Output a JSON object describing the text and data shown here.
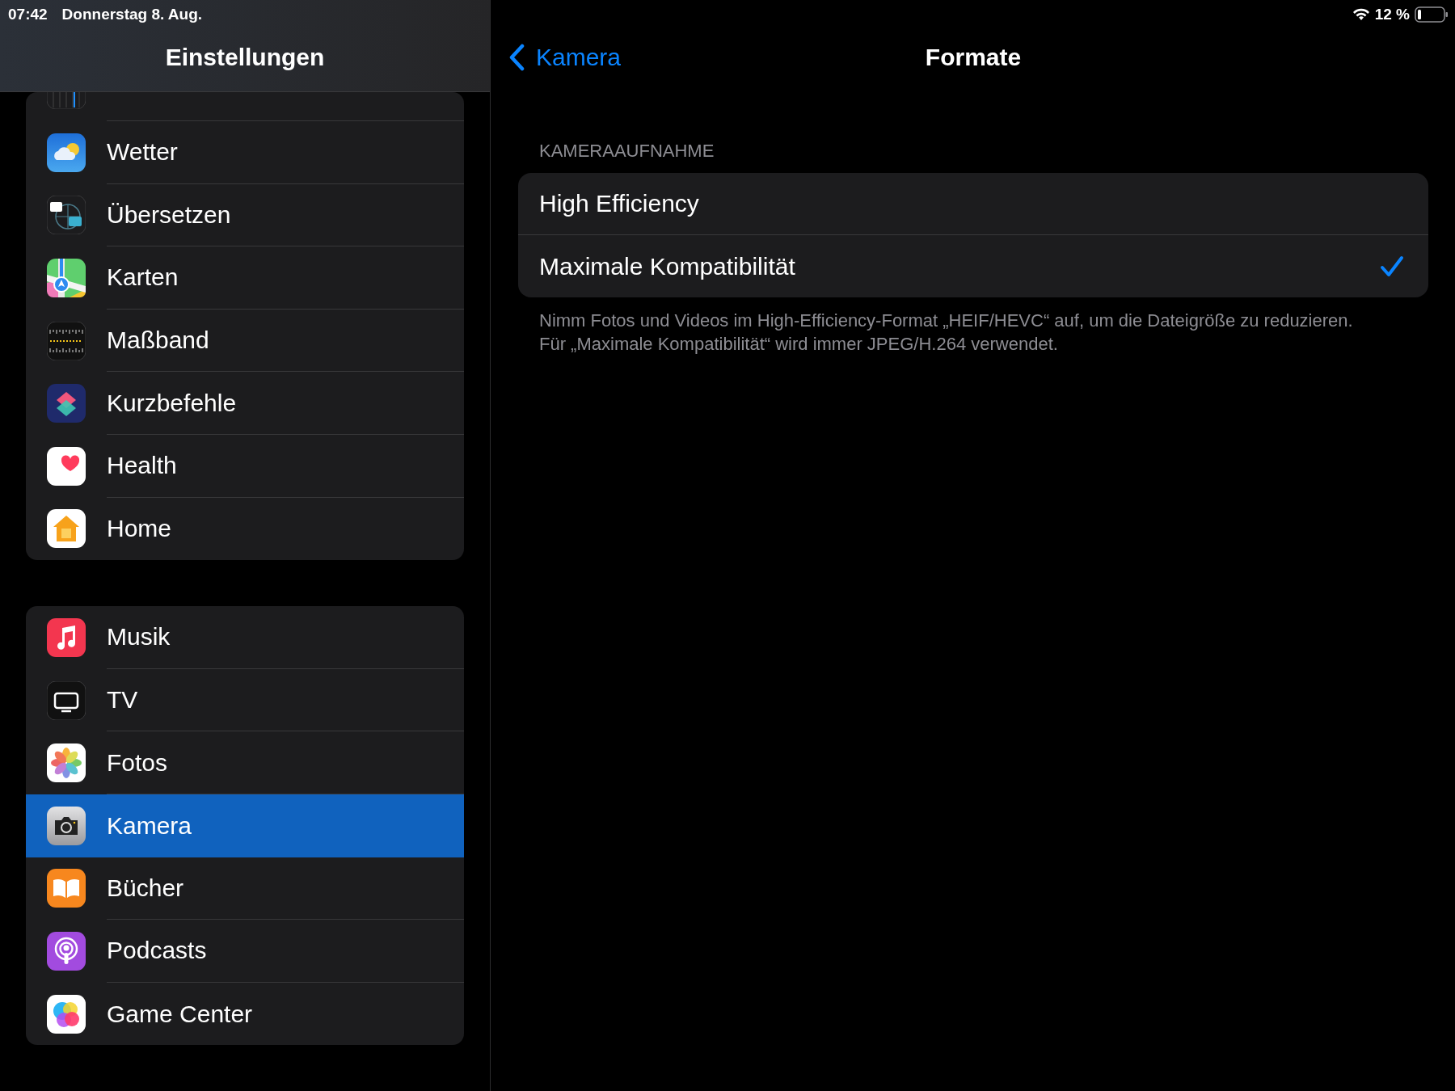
{
  "status_bar": {
    "time": "07:42",
    "date": "Donnerstag 8. Aug.",
    "battery": "12 %"
  },
  "sidebar": {
    "title": "Einstellungen",
    "groups": [
      {
        "items": [
          {
            "label": "Wetter",
            "selected": false
          },
          {
            "label": "Übersetzen",
            "selected": false
          },
          {
            "label": "Karten",
            "selected": false
          },
          {
            "label": "Maßband",
            "selected": false
          },
          {
            "label": "Kurzbefehle",
            "selected": false
          },
          {
            "label": "Health",
            "selected": false
          },
          {
            "label": "Home",
            "selected": false
          }
        ]
      },
      {
        "items": [
          {
            "label": "Musik",
            "selected": false
          },
          {
            "label": "TV",
            "selected": false
          },
          {
            "label": "Fotos",
            "selected": false
          },
          {
            "label": "Kamera",
            "selected": true
          },
          {
            "label": "Bücher",
            "selected": false
          },
          {
            "label": "Podcasts",
            "selected": false
          },
          {
            "label": "Game Center",
            "selected": false
          }
        ]
      }
    ]
  },
  "detail": {
    "back": "Kamera",
    "title": "Formate",
    "section": "KAMERAAUFNAHME",
    "options": [
      {
        "label": "High Efficiency",
        "selected": false
      },
      {
        "label": "Maximale Kompatibilität",
        "selected": true
      }
    ],
    "footer": "Nimm Fotos und Videos im High-Efficiency-Format „HEIF/HEVC“ auf, um die Dateigröße zu reduzieren. Für „Maximale Kompatibilität“ wird immer JPEG/H.264 verwendet."
  }
}
